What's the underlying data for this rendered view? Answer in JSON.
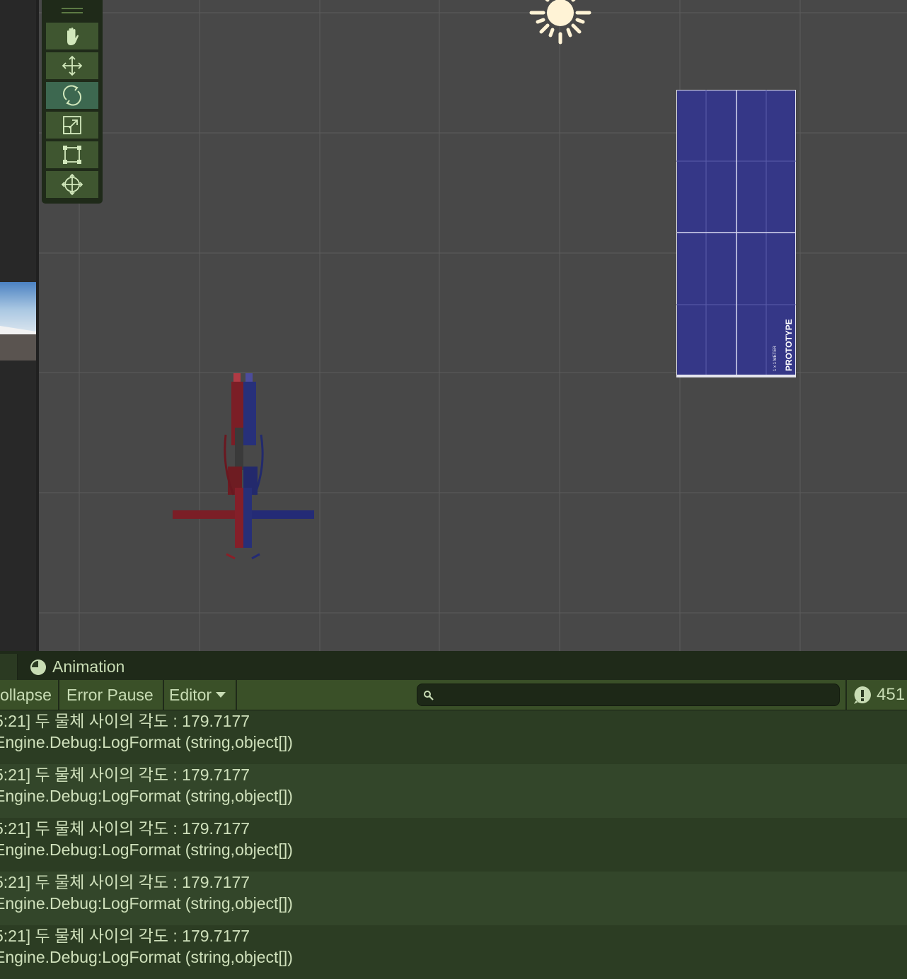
{
  "scene": {
    "tools": [
      {
        "name": "hand-tool",
        "active": false
      },
      {
        "name": "move-tool",
        "active": false
      },
      {
        "name": "rotate-tool",
        "active": true
      },
      {
        "name": "scale-tool",
        "active": false
      },
      {
        "name": "rect-tool",
        "active": false
      },
      {
        "name": "transform-tool",
        "active": false
      }
    ],
    "plane_label": "PROTOTYPE",
    "plane_sublabel": "1 x 1 METER"
  },
  "console": {
    "animation_tab": "Animation",
    "collapse_label": "ollapse",
    "error_pause_label": "Error Pause",
    "editor_label": "Editor",
    "search_placeholder": "",
    "message_count": "451",
    "logs": [
      {
        "line1": "5:21] 두 물체 사이의 각도 : 179.7177",
        "line2": "Engine.Debug:LogFormat (string,object[])"
      },
      {
        "line1": "5:21] 두 물체 사이의 각도 : 179.7177",
        "line2": "Engine.Debug:LogFormat (string,object[])"
      },
      {
        "line1": "5:21] 두 물체 사이의 각도 : 179.7177",
        "line2": "Engine.Debug:LogFormat (string,object[])"
      },
      {
        "line1": "5:21] 두 물체 사이의 각도 : 179.7177",
        "line2": "Engine.Debug:LogFormat (string,object[])"
      },
      {
        "line1": "5:21] 두 물체 사이의 각도 : 179.7177",
        "line2": "Engine.Debug:LogFormat (string,object[])"
      }
    ]
  },
  "colors": {
    "accent_green": "#3f5630",
    "active_tool": "#3d6850",
    "plane_blue": "#353787",
    "console_bg": "#2b3a22"
  }
}
